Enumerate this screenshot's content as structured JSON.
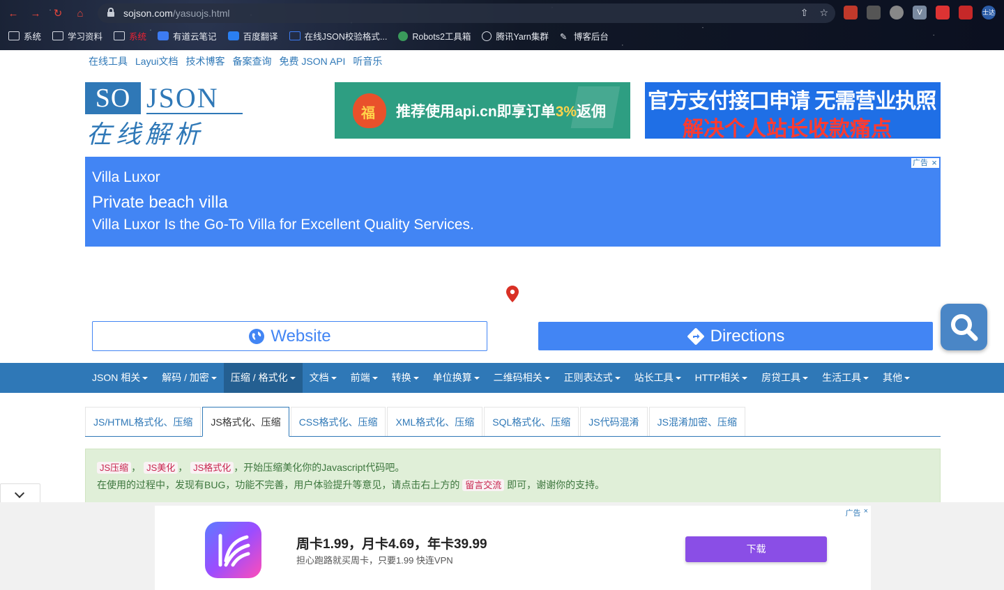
{
  "browser": {
    "url_host": "sojson.com",
    "url_path": "/yasuojs.html",
    "bookmarks": [
      {
        "label": "系统"
      },
      {
        "label": "学习资料"
      },
      {
        "label": "系统"
      },
      {
        "label": "有道云笔记"
      },
      {
        "label": "百度翻译"
      },
      {
        "label": "在线JSON校验格式..."
      },
      {
        "label": "Robots2工具箱"
      },
      {
        "label": "腾讯Yarn集群"
      },
      {
        "label": "博客后台"
      }
    ],
    "profile_label": "士达"
  },
  "topnav": [
    "在线工具",
    "Layui文档",
    "技术博客",
    "备案查询",
    "免费 JSON API",
    "听音乐"
  ],
  "logo": {
    "so": "SO",
    "json": "JSON",
    "cn": "在线解析"
  },
  "banner1": {
    "text_pre": "推荐使用api.cn即享订单",
    "text_hl": "3%",
    "text_post": "返佣"
  },
  "banner2": {
    "line1": "官方支付接口申请 无需营业执照",
    "line2": "解决个人站长收款痛点"
  },
  "bigad": {
    "title": "Villa Luxor",
    "headline": "Private beach villa",
    "desc": "Villa Luxor Is the Go-To Villa for Excellent Quality Services.",
    "ad_label": "广告",
    "website_label": "Website",
    "directions_label": "Directions"
  },
  "mainnav": [
    {
      "label": "JSON 相关"
    },
    {
      "label": "解码 / 加密"
    },
    {
      "label": "压缩 / 格式化",
      "active": true
    },
    {
      "label": "文档"
    },
    {
      "label": "前端"
    },
    {
      "label": "转换"
    },
    {
      "label": "单位换算"
    },
    {
      "label": "二维码相关"
    },
    {
      "label": "正则表达式"
    },
    {
      "label": "站长工具"
    },
    {
      "label": "HTTP相关"
    },
    {
      "label": "房贷工具"
    },
    {
      "label": "生活工具"
    },
    {
      "label": "其他"
    }
  ],
  "tabs": [
    "JS/HTML格式化、压缩",
    "JS格式化、压缩",
    "CSS格式化、压缩",
    "XML格式化、压缩",
    "SQL格式化、压缩",
    "JS代码混淆",
    "JS混淆加密、压缩"
  ],
  "alert": {
    "tag1": "JS压缩",
    "tag2": "JS美化",
    "tag3": "JS格式化",
    "line1_rest": "，开始压缩美化你的Javascript代码吧。",
    "line2_pre": "在使用的过程中，发现有BUG，功能不完善，用户体验提升等意见，请点击右上方的",
    "line2_tag": "留言交流",
    "line2_post": "即可，谢谢你的支持。"
  },
  "bottomad": {
    "title": "周卡1.99，月卡4.69，年卡39.99",
    "desc": "担心跑路就买周卡，只要1.99 快连VPN",
    "button": "下载",
    "ad_label": "广告"
  },
  "colors": {
    "brand": "#2f78b7",
    "ad_blue": "#4285f4",
    "alert_bg": "#e0efd8",
    "download": "#8a4ee6"
  }
}
